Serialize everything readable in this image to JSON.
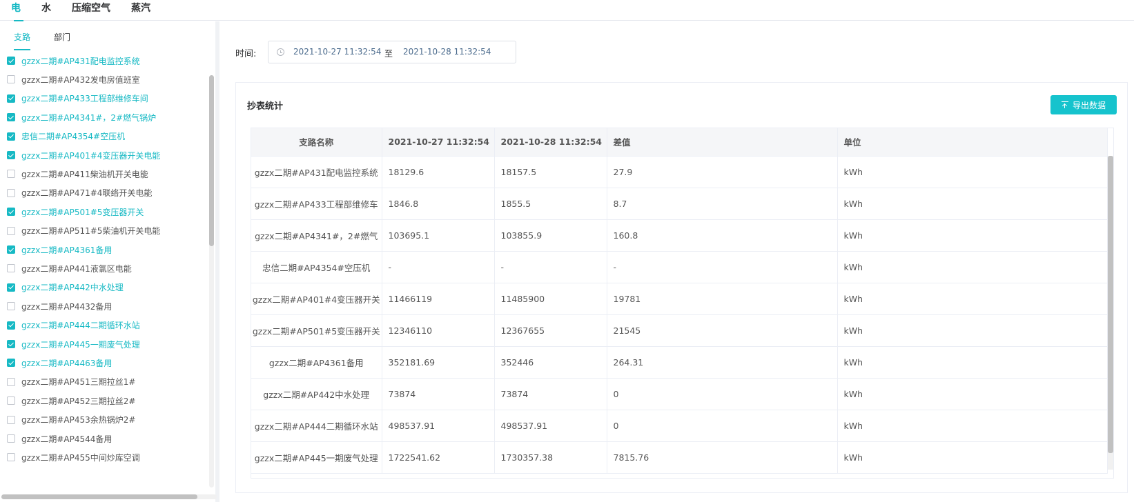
{
  "top_tabs": [
    {
      "label": "电",
      "active": true
    },
    {
      "label": "水",
      "active": false
    },
    {
      "label": "压缩空气",
      "active": false
    },
    {
      "label": "蒸汽",
      "active": false
    }
  ],
  "sub_tabs": [
    {
      "label": "支路",
      "active": true
    },
    {
      "label": "部门",
      "active": false
    }
  ],
  "branches": [
    {
      "label": "gzzx二期#AP431配电监控系统",
      "checked": true
    },
    {
      "label": "gzzx二期#AP432发电房值班室",
      "checked": false
    },
    {
      "label": "gzzx二期#AP433工程部维修车间",
      "checked": true
    },
    {
      "label": "gzzx二期#AP4341#，2#燃气锅炉",
      "checked": true
    },
    {
      "label": "忠信二期#AP4354#空压机",
      "checked": true
    },
    {
      "label": "gzzx二期#AP401#4变压器开关电能",
      "checked": true
    },
    {
      "label": "gzzx二期#AP411柴油机开关电能",
      "checked": false
    },
    {
      "label": "gzzx二期#AP471#4联络开关电能",
      "checked": false
    },
    {
      "label": "gzzx二期#AP501#5变压器开关",
      "checked": true
    },
    {
      "label": "gzzx二期#AP511#5柴油机开关电能",
      "checked": false
    },
    {
      "label": "gzzx二期#AP4361备用",
      "checked": true
    },
    {
      "label": "gzzx二期#AP441液氯区电能",
      "checked": false
    },
    {
      "label": "gzzx二期#AP442中水处理",
      "checked": true
    },
    {
      "label": "gzzx二期#AP4432备用",
      "checked": false
    },
    {
      "label": "gzzx二期#AP444二期循环水站",
      "checked": true
    },
    {
      "label": "gzzx二期#AP445一期废气处理",
      "checked": true
    },
    {
      "label": "gzzx二期#AP4463备用",
      "checked": true
    },
    {
      "label": "gzzx二期#AP451三期拉丝1#",
      "checked": false
    },
    {
      "label": "gzzx二期#AP452三期拉丝2#",
      "checked": false
    },
    {
      "label": "gzzx二期#AP453余热锅炉2#",
      "checked": false
    },
    {
      "label": "gzzx二期#AP4544备用",
      "checked": false
    },
    {
      "label": "gzzx二期#AP455中间炒库空调",
      "checked": false
    }
  ],
  "filter": {
    "time_label": "时间:",
    "start": "2021-10-27 11:32:54",
    "separator": "至",
    "end": "2021-10-28 11:32:54"
  },
  "card": {
    "title": "抄表统计",
    "export_label": "导出数据"
  },
  "table": {
    "headers": [
      "支路名称",
      "2021-10-27 11:32:54",
      "2021-10-28 11:32:54",
      "差值",
      "单位"
    ],
    "rows": [
      [
        "gzzx二期#AP431配电监控系统",
        "18129.6",
        "18157.5",
        "27.9",
        "kWh"
      ],
      [
        "gzzx二期#AP433工程部维修车",
        "1846.8",
        "1855.5",
        "8.7",
        "kWh"
      ],
      [
        "gzzx二期#AP4341#，2#燃气",
        "103695.1",
        "103855.9",
        "160.8",
        "kWh"
      ],
      [
        "忠信二期#AP4354#空压机",
        "-",
        "-",
        "-",
        "kWh"
      ],
      [
        "gzzx二期#AP401#4变压器开关",
        "11466119",
        "11485900",
        "19781",
        "kWh"
      ],
      [
        "gzzx二期#AP501#5变压器开关",
        "12346110",
        "12367655",
        "21545",
        "kWh"
      ],
      [
        "gzzx二期#AP4361备用",
        "352181.69",
        "352446",
        "264.31",
        "kWh"
      ],
      [
        "gzzx二期#AP442中水处理",
        "73874",
        "73874",
        "0",
        "kWh"
      ],
      [
        "gzzx二期#AP444二期循环水站",
        "498537.91",
        "498537.91",
        "0",
        "kWh"
      ],
      [
        "gzzx二期#AP445一期废气处理",
        "1722541.62",
        "1730357.38",
        "7815.76",
        "kWh"
      ]
    ]
  }
}
